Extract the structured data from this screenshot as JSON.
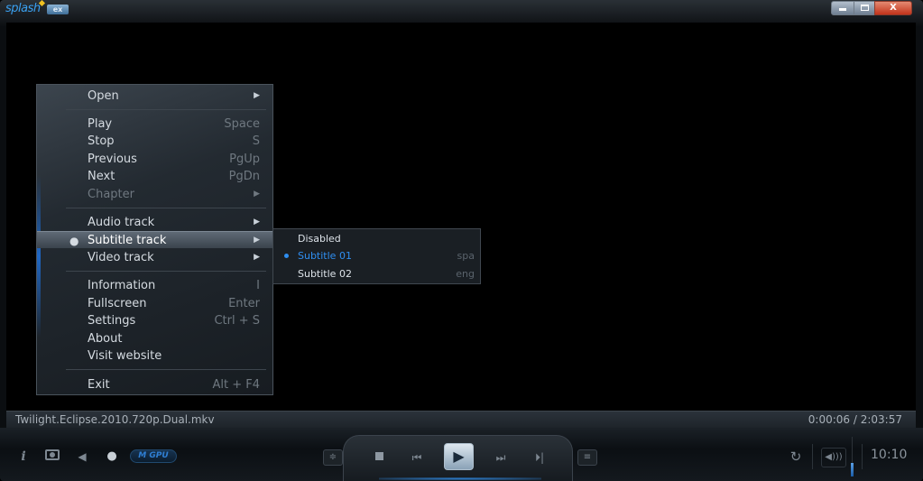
{
  "app": {
    "logo_text": "splash",
    "logo_badge": "ex",
    "min_label": "",
    "max_label": "",
    "close_label": "X"
  },
  "status": {
    "filename": "Twilight.Eclipse.2010.720p.Dual.mkv",
    "time": "0:00:06 / 2:03:57"
  },
  "controls": {
    "info": "i",
    "gpu": "M GPU",
    "prev": "⏮",
    "play": "▶",
    "next": "⏭",
    "step": "⏵|",
    "repeat": "↻",
    "volume": "◀)))",
    "eq": "≑",
    "playlist": "≡",
    "volume_level": 0.35,
    "clock": "10:10"
  },
  "menu": {
    "open": "Open",
    "play": "Play",
    "play_sc": "Space",
    "stop": "Stop",
    "stop_sc": "S",
    "previous": "Previous",
    "previous_sc": "PgUp",
    "next": "Next",
    "next_sc": "PgDn",
    "chapter": "Chapter",
    "audio_track": "Audio track",
    "subtitle_track": "Subtitle track",
    "video_track": "Video track",
    "information": "Information",
    "information_sc": "I",
    "fullscreen": "Fullscreen",
    "fullscreen_sc": "Enter",
    "settings": "Settings",
    "settings_sc": "Ctrl + S",
    "about": "About",
    "visit_website": "Visit website",
    "exit": "Exit",
    "exit_sc": "Alt + F4",
    "arrow": "▶"
  },
  "submenu": {
    "items": [
      {
        "label": "Disabled",
        "lang": ""
      },
      {
        "label": "Subtitle 01",
        "lang": "spa",
        "selected": true
      },
      {
        "label": "Subtitle 02",
        "lang": "eng"
      }
    ]
  },
  "colors": {
    "accent": "#2f8ef0",
    "close_button": "#c2331a"
  }
}
